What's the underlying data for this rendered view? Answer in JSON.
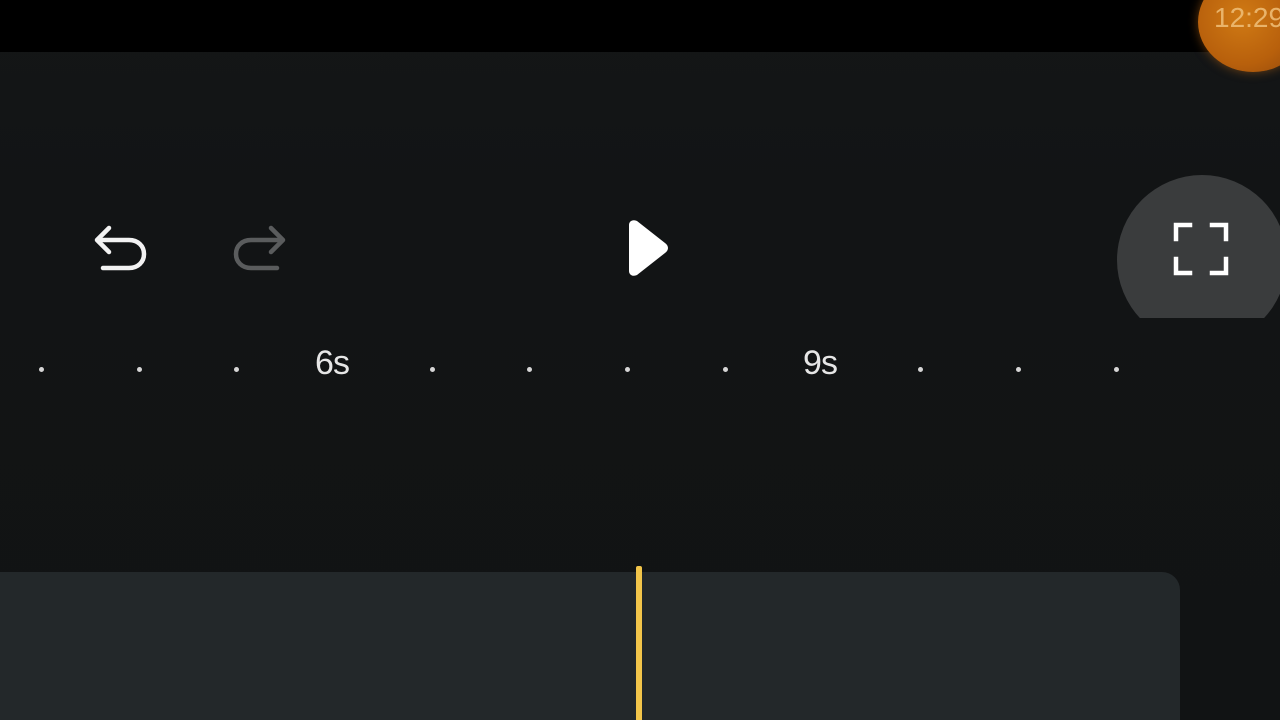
{
  "status_bar": {
    "clock": "12:29"
  },
  "controls": {
    "undo_icon": "undo-arrow-icon",
    "redo_icon": "redo-arrow-icon",
    "redo_enabled": false,
    "play_icon": "play-icon",
    "fullscreen_icon": "fullscreen-icon"
  },
  "timeline": {
    "ruler_labels": [
      "6s",
      "9s"
    ],
    "playhead_color": "#f2c54a"
  },
  "colors": {
    "background": "#111314",
    "track": "#23282a",
    "accent": "#f2c54a",
    "clock_badge": "#c0680f"
  }
}
